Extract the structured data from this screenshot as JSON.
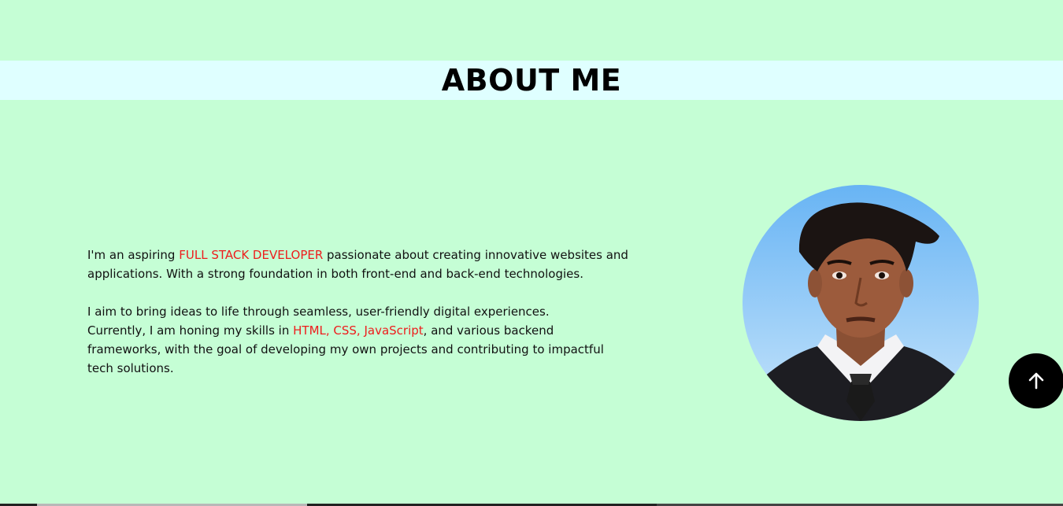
{
  "section": {
    "title": "ABOUT ME"
  },
  "about": {
    "line1_prefix": "I'm an aspiring ",
    "line1_highlight": "FULL STACK DEVELOPER",
    "line1_suffix": " passionate about creating innovative websites and applications. With a strong foundation in both front-end and back-end technologies.",
    "line2": "I aim to bring ideas to life through seamless, user-friendly digital experiences.",
    "line3_prefix": "Currently, I am honing my skills in ",
    "line3_highlight": "HTML, CSS, JavaScript",
    "line3_suffix": ", and various backend frameworks, with the goal of developing my own projects and contributing to impactful tech solutions."
  },
  "profile": {
    "photo_alt": "profile-photo"
  },
  "scroll_top": {
    "icon": "arrow-up-icon"
  },
  "colors": {
    "background": "#c5fed5",
    "title_band": "#dfffff",
    "highlight": "#ee1c1c",
    "button": "#000000"
  }
}
